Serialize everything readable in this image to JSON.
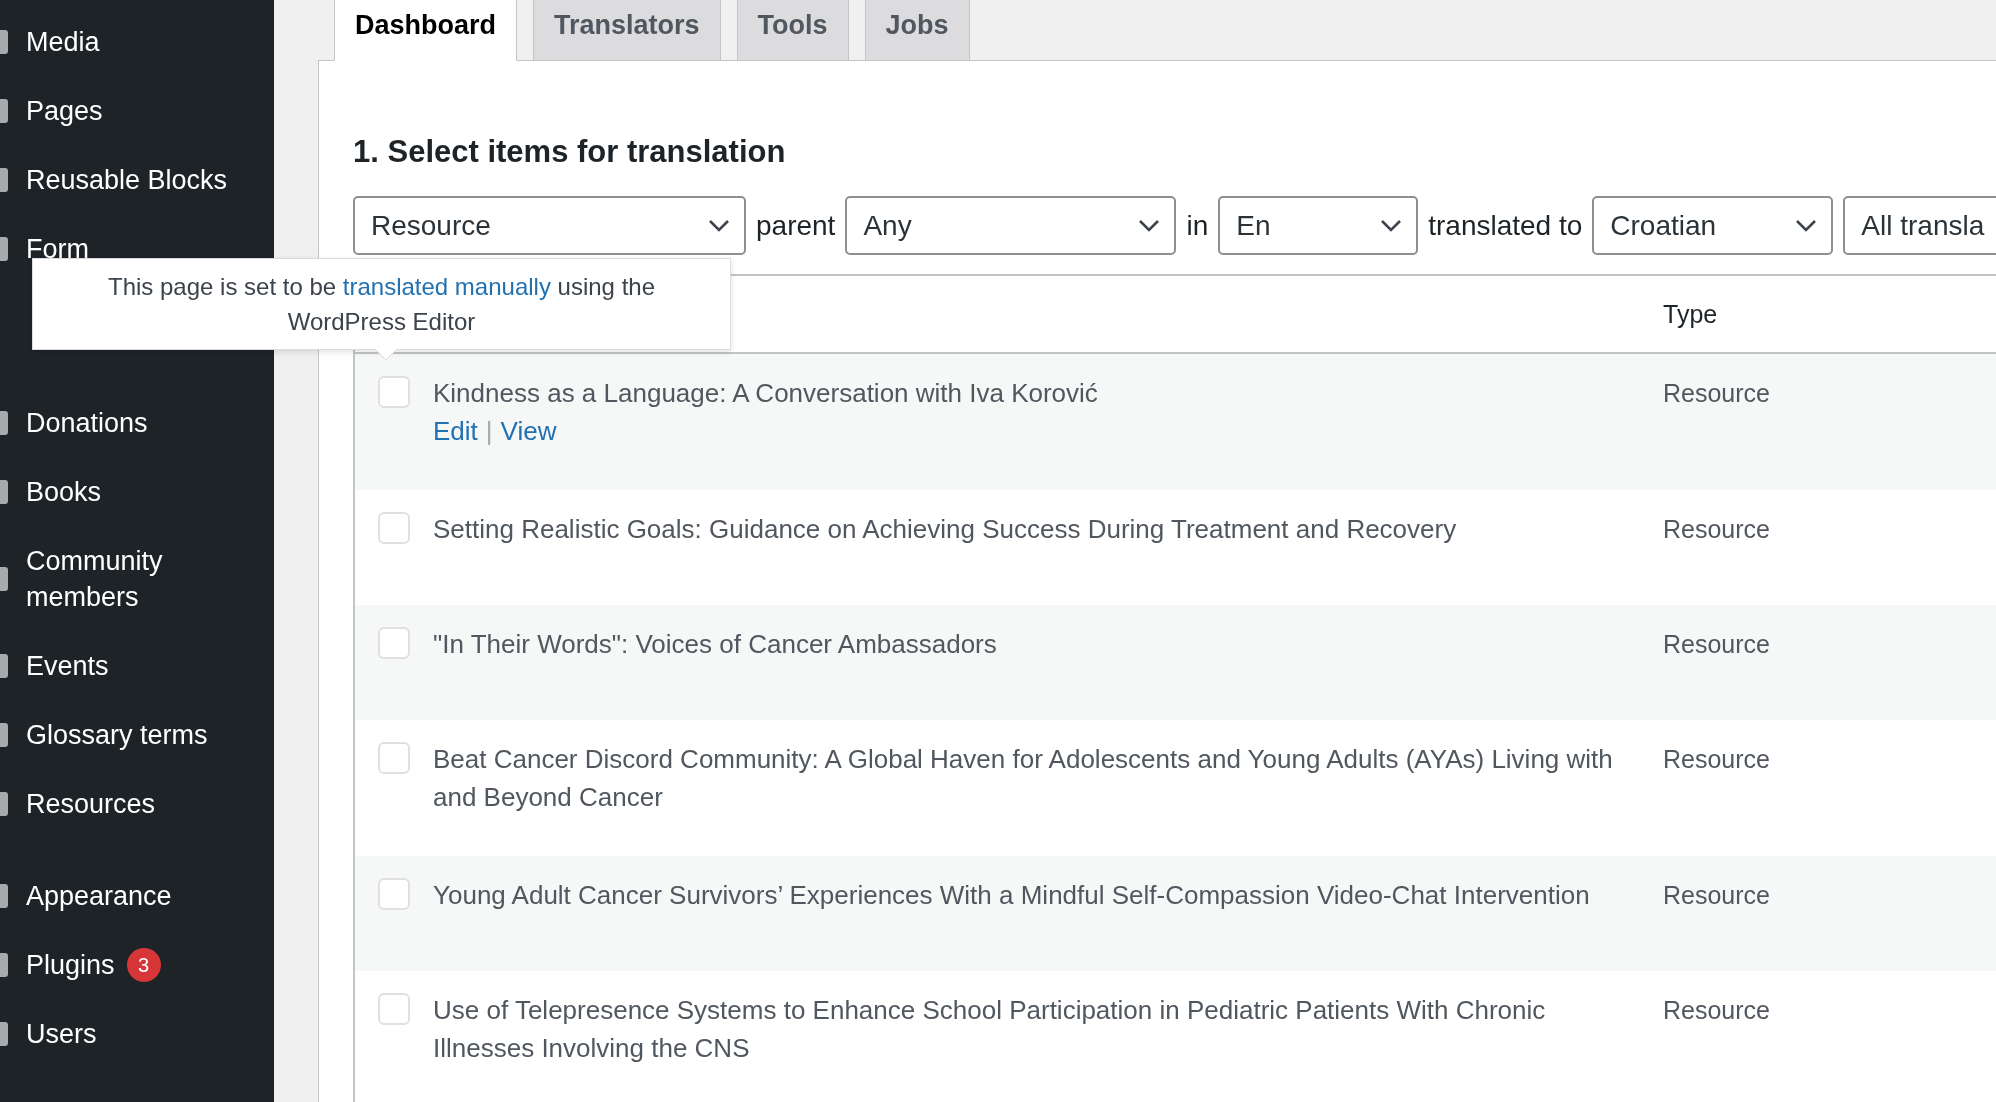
{
  "sidebar": {
    "items": [
      {
        "label": "Media"
      },
      {
        "label": "Pages"
      },
      {
        "label": "Reusable Blocks"
      },
      {
        "label": "Form"
      },
      {
        "label": "Donations"
      },
      {
        "label": "Books"
      },
      {
        "label": "Community members"
      },
      {
        "label": "Events"
      },
      {
        "label": "Glossary terms"
      },
      {
        "label": "Resources"
      },
      {
        "label": "Appearance",
        "group_start": true
      },
      {
        "label": "Plugins",
        "badge": "3"
      },
      {
        "label": "Users"
      }
    ]
  },
  "tabs": [
    {
      "label": "Dashboard",
      "selected": true
    },
    {
      "label": "Translators",
      "selected": false
    },
    {
      "label": "Tools",
      "selected": false
    },
    {
      "label": "Jobs",
      "selected": false
    }
  ],
  "heading": "1. Select items for translation",
  "filters": [
    {
      "kind": "select",
      "value": "Resource"
    },
    {
      "kind": "label",
      "text": "parent"
    },
    {
      "kind": "select",
      "value": "Any"
    },
    {
      "kind": "label",
      "text": "in"
    },
    {
      "kind": "select",
      "value": "En"
    },
    {
      "kind": "label",
      "text": "translated to"
    },
    {
      "kind": "select",
      "value": "Croatian"
    },
    {
      "kind": "select",
      "value": "All transla"
    }
  ],
  "table": {
    "columns": [
      {
        "label": "Type"
      }
    ],
    "rows": [
      {
        "title": "Kindness as a Language: A Conversation with Iva Korović",
        "type": "Resource",
        "checked": false,
        "actions": [
          "Edit",
          "View"
        ],
        "separator": "|"
      },
      {
        "title": "Setting Realistic Goals: Guidance on Achieving Success During Treatment and Recovery",
        "type": "Resource",
        "checked": false
      },
      {
        "title": "\"In Their Words\": Voices of Cancer Ambassadors",
        "type": "Resource",
        "checked": false
      },
      {
        "title": "Beat Cancer Discord Community: A Global Haven for Adolescents and Young Adults (AYAs) Living with and Beyond Cancer",
        "type": "Resource",
        "checked": false
      },
      {
        "title": "Young Adult Cancer Survivors’ Experiences With a Mindful Self-Compassion Video-Chat Intervention",
        "type": "Resource",
        "checked": false
      },
      {
        "title": "Use of Telepresence Systems to Enhance School Participation in Pediatric Patients With Chronic Illnesses Involving the CNS",
        "type": "Resource",
        "checked": false
      }
    ]
  },
  "tooltip": {
    "text_before": "This page is set to be ",
    "link": "translated manually",
    "text_after": " using the WordPress Editor"
  }
}
